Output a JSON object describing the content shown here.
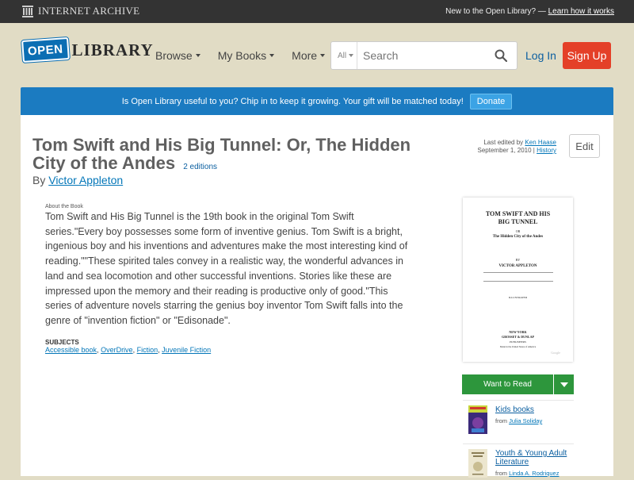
{
  "ia_bar": {
    "logo_text": "INTERNET ARCHIVE",
    "promo_text": "New to the Open Library? —",
    "promo_link": "Learn how it works"
  },
  "header": {
    "logo_open": "OPEN",
    "logo_library": "LIBRARY",
    "nav": [
      {
        "label": "Browse"
      },
      {
        "label": "My Books"
      },
      {
        "label": "More"
      }
    ],
    "search_scope": "All",
    "search_placeholder": "Search",
    "login_label": "Log In",
    "signup_label": "Sign Up"
  },
  "donate": {
    "text": "Is Open Library useful to you? Chip in to keep it growing. Your gift will be matched today!",
    "button": "Donate"
  },
  "book": {
    "title": "Tom Swift and His Big Tunnel: Or, The Hidden City of the Andes",
    "editions": "2 editions",
    "by": "By",
    "author": "Victor Appleton",
    "last_edited_prefix": "Last edited by",
    "last_edited_by": "Ken Haase",
    "last_edited_date": "September 1, 2010 |",
    "history_link": "History",
    "edit_label": "Edit",
    "about_label": "About the Book",
    "description": "Tom Swift and His Big Tunnel is the 19th book in the original Tom Swift series.\"Every boy possesses some form of inventive genius. Tom Swift is a bright, ingenious boy and his inventions and adventures make the most interesting kind of reading.\"\"These spirited tales convey in a realistic way, the wonderful advances in land and sea locomotion and other successful inventions. Stories like these are impressed upon the memory and their reading is productive only of good.\"This series of adventure novels starring the genius boy inventor Tom Swift falls into the genre of \"invention fiction\" or \"Edisonade\".",
    "subjects_label": "SUBJECTS",
    "subjects": [
      "Accessible book",
      "OverDrive",
      "Fiction",
      "Juvenile Fiction"
    ]
  },
  "cover": {
    "title_line1": "TOM SWIFT AND HIS",
    "title_line2": "BIG TUNNEL",
    "or": "OR",
    "subtitle": "The Hidden City of the Andes",
    "by": "BY",
    "author": "VICTOR APPLETON",
    "illustrated": "ILLUSTRATED",
    "city": "NEW YORK",
    "publisher": "GROSSET & DUNLAP",
    "publishers": "PUBLISHERS",
    "made_in": "Made in the United States of America",
    "scan_mark": "Google"
  },
  "sidebar": {
    "want_to_read": "Want to Read",
    "lists": [
      {
        "name": "Kids books",
        "from_prefix": "from",
        "from": "Julia Soliday"
      },
      {
        "name": "Youth & Young Adult Literature",
        "from_prefix": "from",
        "from": "Linda A. Rodriquez"
      }
    ]
  }
}
